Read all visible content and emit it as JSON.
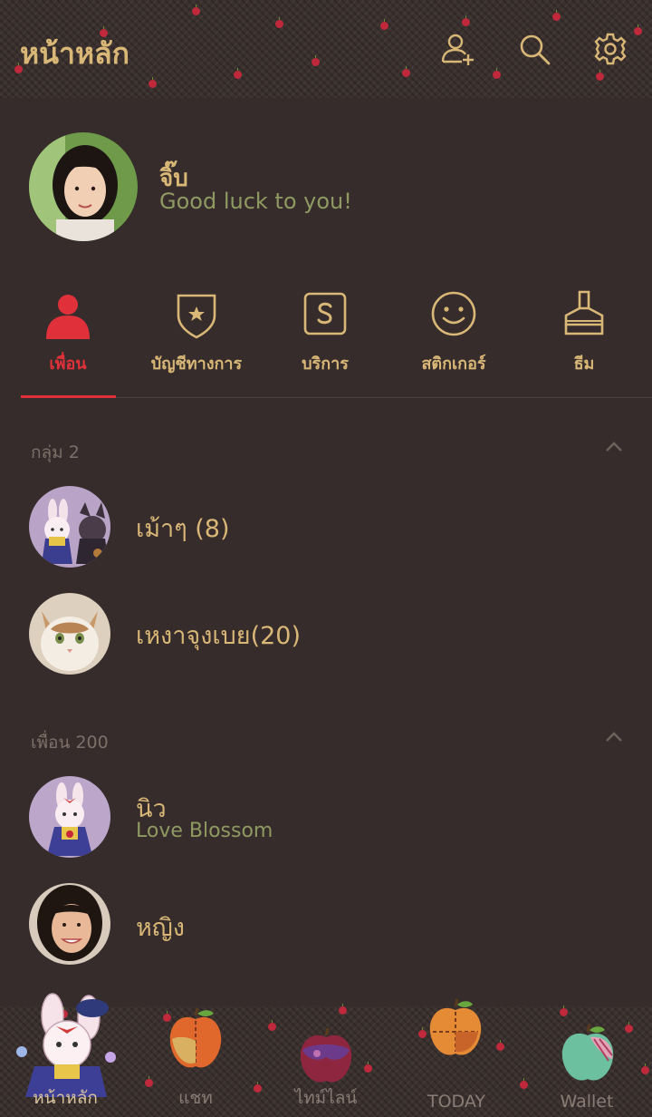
{
  "header": {
    "title": "หน้าหลัก",
    "icons": [
      "add-friend-icon",
      "search-icon",
      "gear-icon"
    ]
  },
  "profile": {
    "name": "จิ๊บ",
    "status": "Good luck to you!"
  },
  "tabs": [
    {
      "label": "เพื่อน",
      "icon": "person-icon",
      "active": true
    },
    {
      "label": "บัญชีทางการ",
      "icon": "shield-star-icon",
      "active": false
    },
    {
      "label": "บริการ",
      "icon": "service-s-icon",
      "active": false
    },
    {
      "label": "สติกเกอร์",
      "icon": "smiley-icon",
      "active": false
    },
    {
      "label": "ธีม",
      "icon": "brush-icon",
      "active": false
    }
  ],
  "groups_section": {
    "label": "กลุ่ม 2",
    "items": [
      {
        "name": "เม้าๆ (8)"
      },
      {
        "name": "เหงาจุงเบย(20)"
      }
    ]
  },
  "friends_section": {
    "label": "เพื่อน 200",
    "items": [
      {
        "name": "นิว",
        "status": "Love Blossom"
      },
      {
        "name": "หญิง",
        "status": ""
      }
    ]
  },
  "bottom_nav": [
    {
      "label": "หน้าหลัก",
      "active": true
    },
    {
      "label": "แชท",
      "active": false
    },
    {
      "label": "ไทม์ไลน์",
      "active": false
    },
    {
      "label": "TODAY",
      "active": false
    },
    {
      "label": "Wallet",
      "active": false
    }
  ],
  "colors": {
    "background": "#352c2b",
    "gold_text": "#d9b777",
    "accent_red": "#e0303a",
    "status_green": "#8f9a62",
    "muted": "#7e7068"
  }
}
